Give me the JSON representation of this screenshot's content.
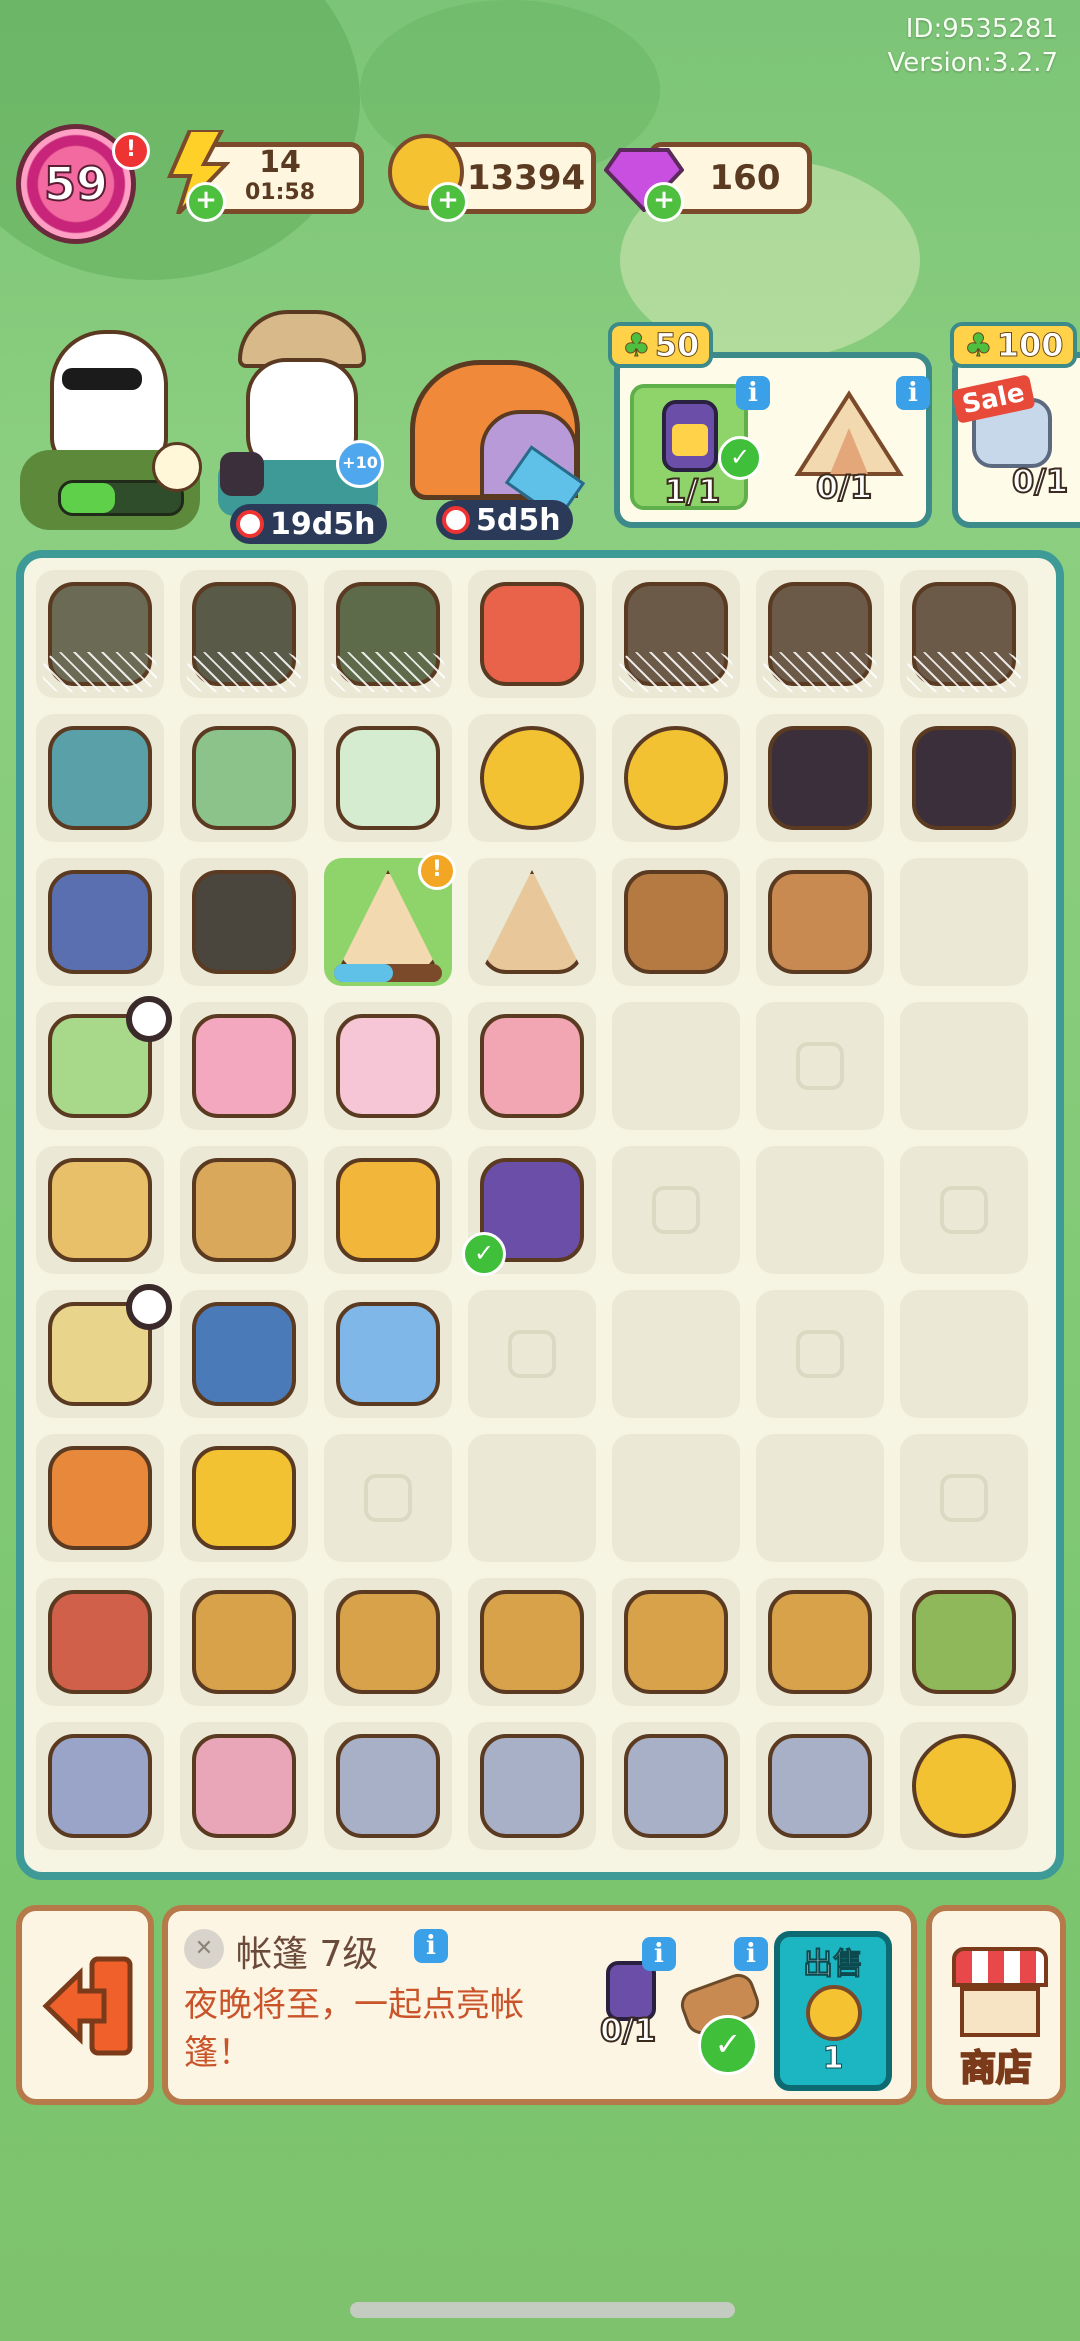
{
  "meta": {
    "id": "ID:9535281",
    "version": "Version:3.2.7"
  },
  "hud": {
    "level": "59",
    "energy": {
      "value": "14",
      "timer": "01:58"
    },
    "coins": "13394",
    "gems": "160"
  },
  "characters": [
    {
      "name": "dj-goose",
      "progress": 0.45
    },
    {
      "name": "explorer-goose",
      "timer": "19d5h",
      "bonus": "+10"
    },
    {
      "name": "tent-house",
      "timer": "5d5h"
    }
  ],
  "orders": [
    {
      "reward": "50",
      "items": [
        {
          "name": "lantern",
          "count": "1/1",
          "done": true
        },
        {
          "name": "tent",
          "count": "0/1",
          "done": false
        }
      ]
    },
    {
      "reward": "100",
      "sale": "Sale",
      "items": [
        {
          "name": "tool",
          "count": "0/1",
          "done": false
        }
      ]
    }
  ],
  "task": {
    "title": "帐篷 7级",
    "description": "夜晚将至，一起点亮帐篷！",
    "req1_count": "0/1",
    "sell_label": "出售",
    "sell_value": "1",
    "shop_label": "商店"
  },
  "colors": {
    "teal": "#3e9a96",
    "brown": "#7b4a2a",
    "green": "#4fbf3f"
  },
  "board": [
    [
      "suitcase-web",
      "bag-web",
      "chest-web",
      "thread-spools",
      "branch-web",
      "branch-web",
      "branch-web"
    ],
    [
      "telescope",
      "handheld-game",
      "mahjong-tiles",
      "coin-pile",
      "coin-stack",
      "coal",
      "coal-lumps"
    ],
    [
      "trash-bags",
      "trash-bag",
      "tent-producer",
      "tent-frame",
      "logs",
      "log",
      "empty"
    ],
    [
      "blossom-tree",
      "flower-wreath",
      "cherry-blossom",
      "flower-bud",
      "empty",
      "locked",
      "empty"
    ],
    [
      "bucket",
      "ice-bucket",
      "soda-bottles",
      "lantern",
      "locked",
      "empty",
      "locked"
    ],
    [
      "bbq-grill-cart",
      "chess-board",
      "bug-net",
      "locked",
      "empty",
      "locked",
      "empty"
    ],
    [
      "kebab-skewers",
      "corn-skewer",
      "locked",
      "empty",
      "empty",
      "empty",
      "locked"
    ],
    [
      "roast-meat",
      "food-basket",
      "food-basket",
      "food-basket",
      "food-basket",
      "food-basket",
      "asparagus-eggs"
    ],
    [
      "picnic-cooler",
      "tableware-set",
      "cutlery-cup",
      "cutlery-cup",
      "cutlery-cup",
      "cutlery-cup",
      "gold-coins"
    ]
  ]
}
